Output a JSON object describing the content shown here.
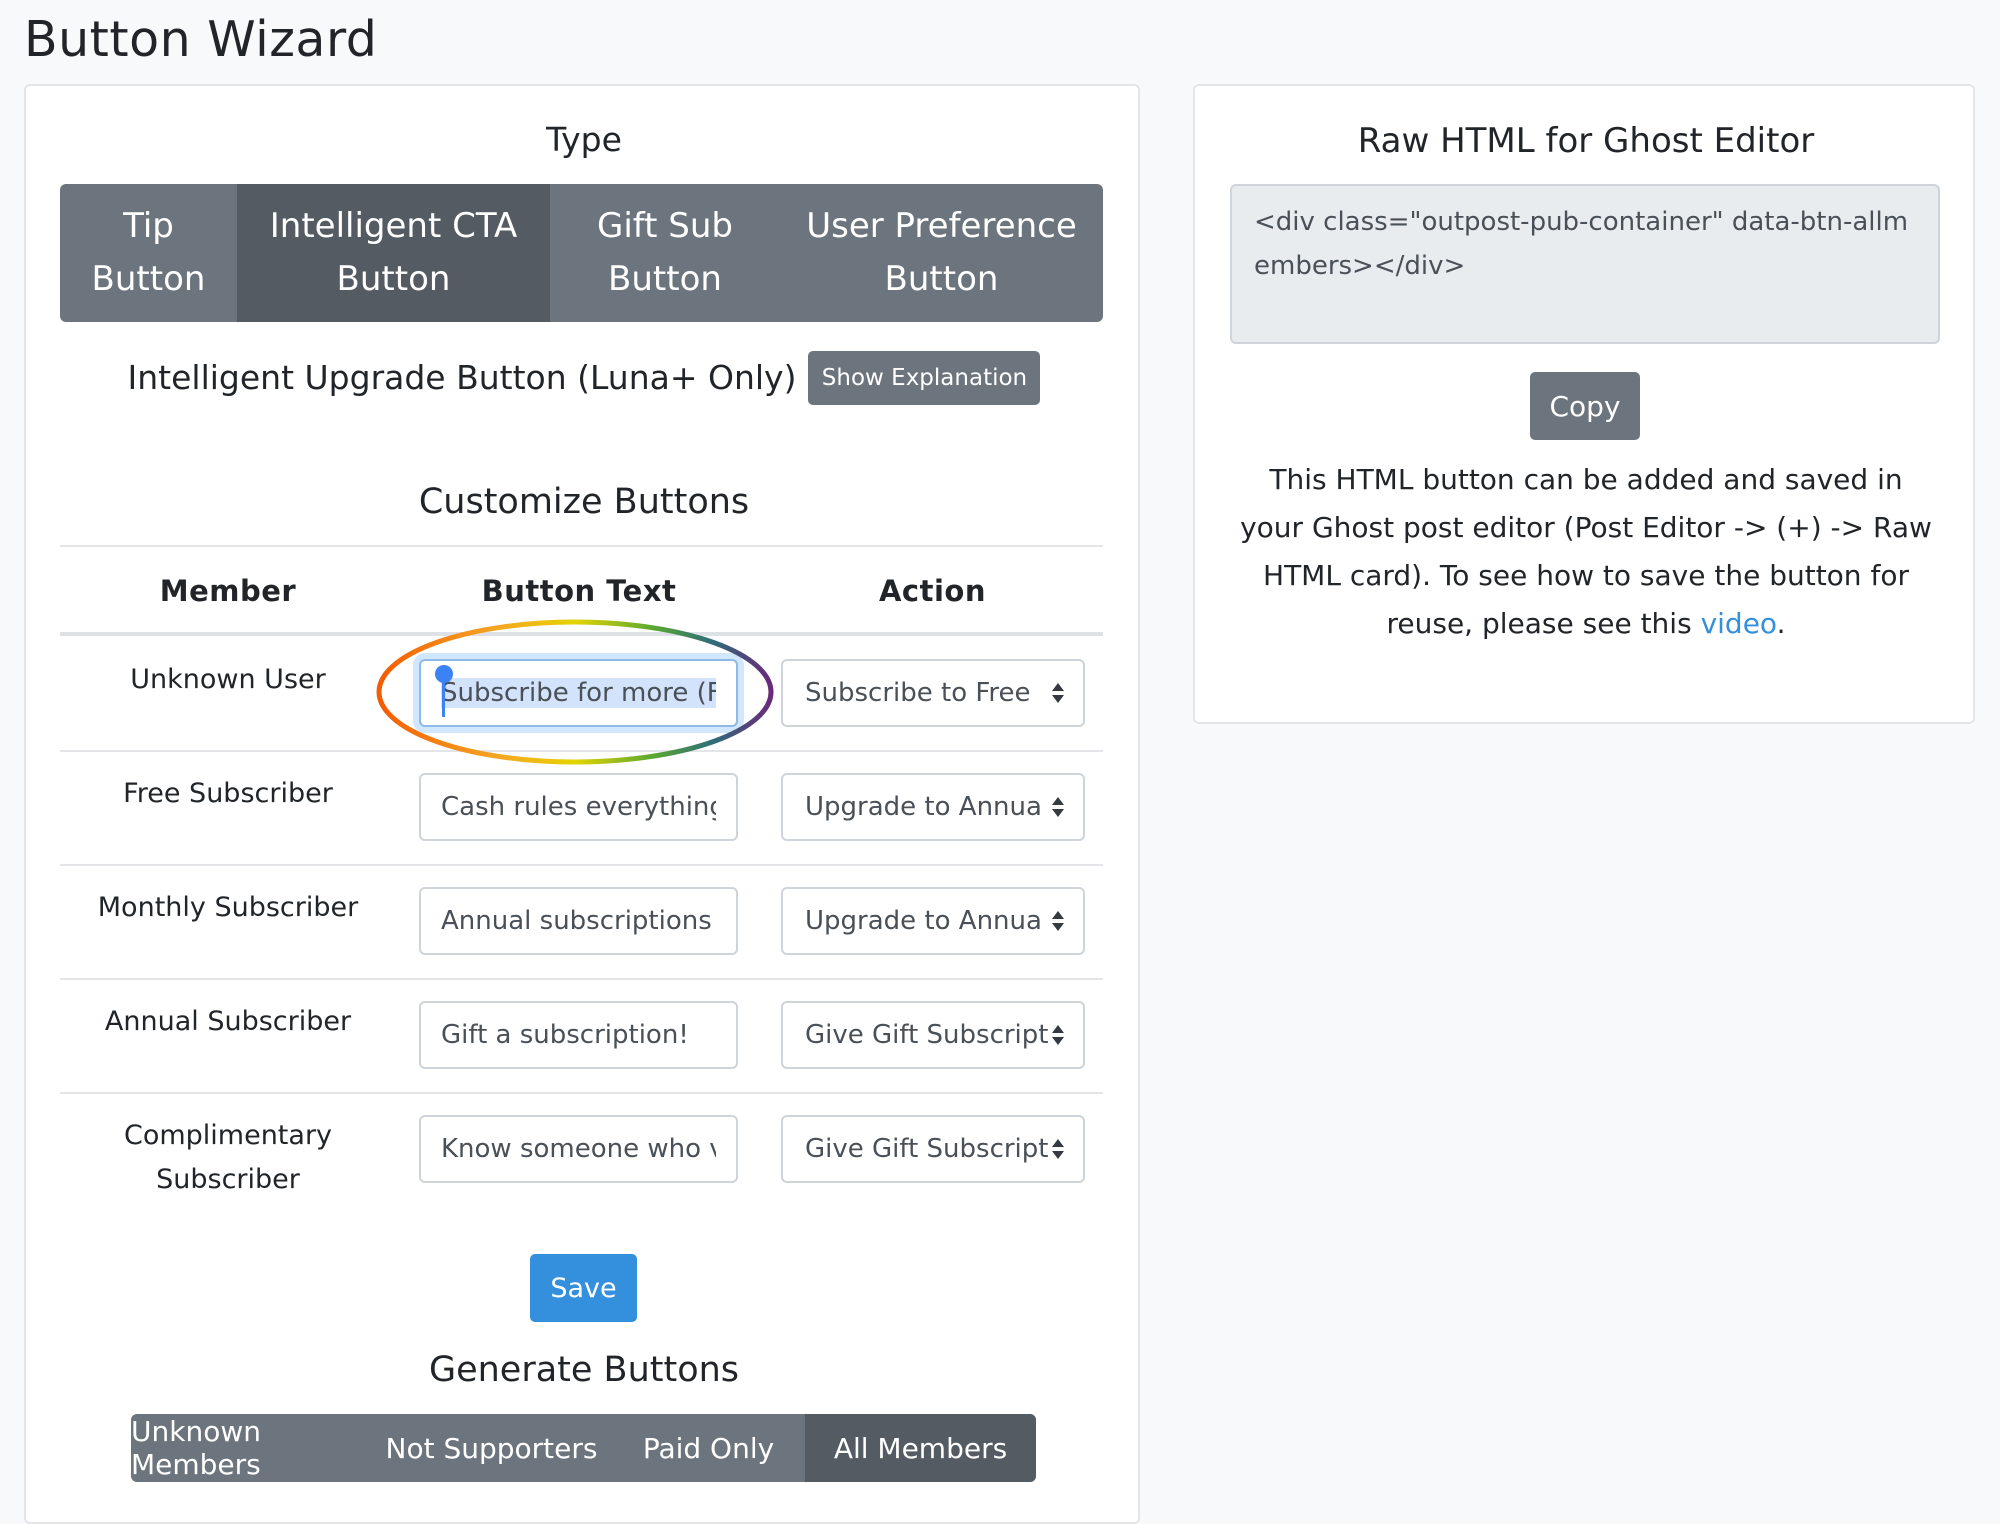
{
  "page": {
    "title": "Button Wizard"
  },
  "type_section": {
    "heading": "Type",
    "tabs": [
      {
        "line1": "Tip",
        "line2": "Button",
        "active": false
      },
      {
        "line1": "Intelligent CTA",
        "line2": "Button",
        "active": true
      },
      {
        "line1": "Gift Sub",
        "line2": "Button",
        "active": false
      },
      {
        "line1": "User Preference",
        "line2": "Button",
        "active": false
      }
    ],
    "subtitle": "Intelligent Upgrade Button (Luna+ Only)",
    "show_explanation_label": "Show Explanation"
  },
  "customize": {
    "heading": "Customize Buttons",
    "columns": [
      "Member",
      "Button Text",
      "Action"
    ],
    "rows": [
      {
        "member": "Unknown User",
        "button_text": "Subscribe for more (Fi",
        "action": "Subscribe to Free",
        "focused": true
      },
      {
        "member": "Free Subscriber",
        "button_text": "Cash rules everything",
        "action": "Upgrade to Annua"
      },
      {
        "member": "Monthly Subscriber",
        "button_text": "Annual subscriptions",
        "action": "Upgrade to Annua"
      },
      {
        "member": "Annual Subscriber",
        "button_text": "Gift a subscription!",
        "action": "Give Gift Subscript"
      },
      {
        "member_line1": "Complimentary",
        "member_line2": "Subscriber",
        "button_text": "Know someone who v",
        "action": "Give Gift Subscript"
      }
    ],
    "save_label": "Save"
  },
  "generate": {
    "heading": "Generate Buttons",
    "options": [
      {
        "label": "Unknown Members",
        "active": false
      },
      {
        "label": "Not Supporters",
        "active": false
      },
      {
        "label": "Paid Only",
        "active": false
      },
      {
        "label": "All Members",
        "active": true
      }
    ]
  },
  "raw_html": {
    "heading": "Raw HTML for Ghost Editor",
    "code": "<div class=\"outpost-pub-container\" data-btn-allmembers></div>",
    "copy_label": "Copy",
    "help_text_before": "This HTML button can be added and saved in your Ghost post editor (Post Editor -> (+) -> Raw HTML card). To see how to save the button for reuse, please see this ",
    "help_link": "video",
    "help_text_after": "."
  },
  "colors": {
    "secondary": "#6c757d",
    "secondary_active": "#545b62",
    "primary": "#3490dc",
    "background": "#f8f9fa"
  }
}
